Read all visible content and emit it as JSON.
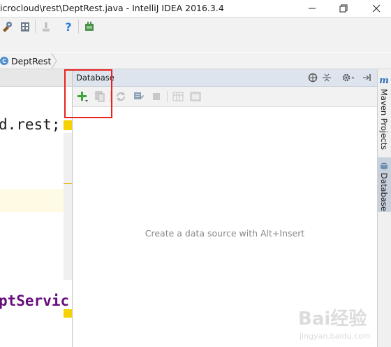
{
  "window": {
    "title": "icrocloud\\rest\\DeptRest.java - IntelliJ IDEA 2016.3.4",
    "controls": [
      "minimize-icon",
      "restore-icon",
      "close-icon"
    ]
  },
  "toolbar": {
    "icons": [
      "project-structure-icon",
      "sdk-icon",
      "vcs-disabled-icon",
      "help-icon",
      "plugin-icon"
    ],
    "help_label": "?"
  },
  "navbar": {
    "class_icon_letter": "C",
    "crumb": "DeptRest"
  },
  "editor": {
    "line_1": "d.rest;",
    "line_2": "ptServic"
  },
  "database_panel": {
    "title": "Database",
    "header_icons": [
      "target-icon",
      "collapse-all-icon",
      "settings-icon",
      "hide-icon"
    ],
    "toolbar_icons": [
      "add-icon",
      "copy-icon",
      "refresh-icon",
      "properties-icon",
      "stop-icon",
      "table-icon",
      "console-icon"
    ],
    "empty_message": "Create a data source with Alt+Insert"
  },
  "side_stripe": {
    "maven_icon_letter": "m",
    "maven_label": "Maven Projects",
    "database_label": "Database"
  },
  "watermark": {
    "text": "Bai经验",
    "sub": "jingyan.baidu.com"
  },
  "colors": {
    "highlight": "#e8221f",
    "db_header": "#dde4ee",
    "add_green": "#3aa63a",
    "keyword_purple": "#660e7a"
  }
}
